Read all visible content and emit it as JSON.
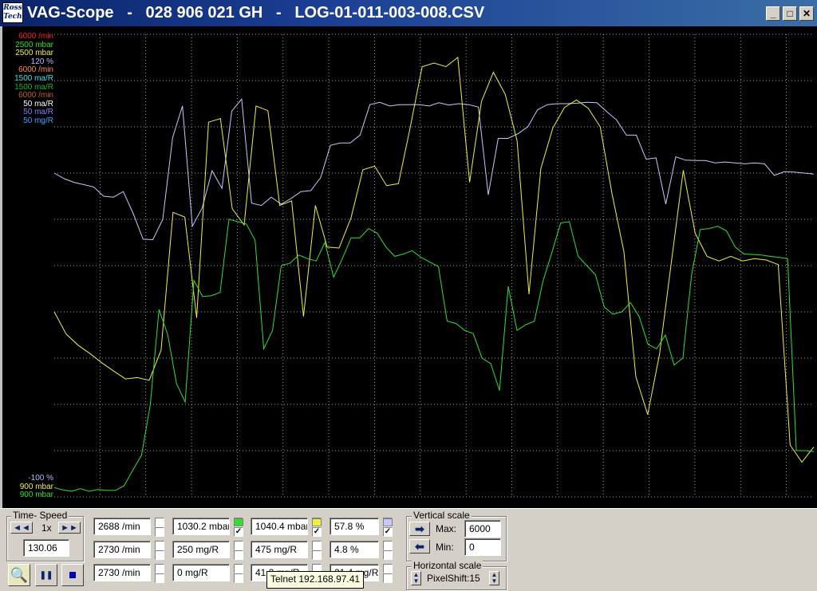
{
  "window": {
    "title": "VAG-Scope   -   028 906 021 GH   -   LOG-01-011-003-008.CSV",
    "logo": "Ross Tech"
  },
  "scale_labels_top": [
    {
      "text": "6000 /min",
      "color": "#ff2020"
    },
    {
      "text": "2500 mbar",
      "color": "#30e030"
    },
    {
      "text": "2500 mbar",
      "color": "#f0f040"
    },
    {
      "text": "120 %",
      "color": "#b8b8ff"
    },
    {
      "text": "6000 /min",
      "color": "#ff9040"
    },
    {
      "text": "1500 ma/R",
      "color": "#40e0e0"
    },
    {
      "text": "1500 ma/R",
      "color": "#20b020"
    },
    {
      "text": "6000 /min",
      "color": "#c06030"
    },
    {
      "text": "50 ma/R",
      "color": "#ffffff"
    },
    {
      "text": "50 ma/R",
      "color": "#8080ff"
    },
    {
      "text": "50 mg/R",
      "color": "#40a0ff"
    }
  ],
  "scale_labels_bottom": [
    {
      "text": "-100 %",
      "color": "#b8b8ff"
    },
    {
      "text": "900 mbar",
      "color": "#f0f040"
    },
    {
      "text": "900 mbar",
      "color": "#30e030"
    }
  ],
  "chart_data": {
    "type": "line",
    "ylim": [
      0,
      1000
    ],
    "grid": true,
    "series": [
      {
        "color": "#c8c8ff",
        "values": [
          700,
          688,
          680,
          675,
          670,
          650,
          648,
          660,
          613,
          557,
          556,
          600,
          777,
          845,
          585,
          625,
          705,
          667,
          834,
          860,
          635,
          630,
          648,
          633,
          645,
          660,
          662,
          690,
          760,
          765,
          765,
          782,
          848,
          853,
          845,
          848,
          848,
          848,
          845,
          852,
          847,
          850,
          848,
          843,
          653,
          775,
          775,
          785,
          800,
          837,
          848,
          850,
          850,
          851,
          853,
          852,
          833,
          815,
          782,
          782,
          730,
          733,
          633,
          735,
          728,
          727,
          727,
          722,
          724,
          722,
          720,
          722,
          720,
          695,
          703,
          702,
          700,
          698
        ]
      },
      {
        "color": "#f0f040",
        "values": [
          400,
          352,
          328,
          310,
          290,
          272,
          255,
          258,
          252,
          317,
          615,
          605,
          387,
          810,
          818,
          623,
          588,
          845,
          835,
          630,
          640,
          390,
          630,
          540,
          538,
          603,
          707,
          715,
          673,
          677,
          800,
          930,
          938,
          930,
          950,
          680,
          855,
          918,
          870,
          770,
          438,
          710,
          797,
          842,
          858,
          840,
          800,
          655,
          530,
          260,
          178,
          308,
          508,
          706,
          570,
          520,
          510,
          520,
          510,
          515,
          512,
          502,
          112,
          75,
          108
        ]
      },
      {
        "color": "#30e030",
        "values": [
          20,
          15,
          12,
          18,
          12,
          16,
          14,
          14,
          24,
          58,
          90,
          200,
          405,
          350,
          245,
          205,
          468,
          433,
          435,
          442,
          600,
          595,
          590,
          555,
          320,
          360,
          500,
          505,
          523,
          515,
          510,
          550,
          475,
          515,
          560,
          560,
          580,
          570,
          540,
          520,
          525,
          532,
          518,
          508,
          498,
          380,
          375,
          360,
          353,
          300,
          288,
          230,
          455,
          360,
          372,
          380,
          468,
          528,
          592,
          595,
          520,
          500,
          480,
          410,
          395,
          400,
          420,
          390,
          330,
          320,
          350,
          285,
          300,
          480,
          578,
          580,
          585,
          575,
          540,
          525,
          524,
          523,
          520,
          518,
          515,
          100,
          100,
          98
        ]
      }
    ]
  },
  "controls": {
    "time_speed": {
      "label": "Time- Speed",
      "speed": "1x",
      "time_value": "130.06"
    },
    "values": [
      [
        "2688 /min",
        "1030.2 mbar",
        "1040.4 mbar",
        "57.8 %"
      ],
      [
        "2730 /min",
        "250 mg/R",
        "475 mg/R",
        "4.8 %"
      ],
      [
        "2730 /min",
        "0 mg/R",
        "41.2 mg/R",
        "21.4 mg/R"
      ]
    ],
    "swatch_colors": [
      "#30e030",
      "#f0f040",
      "#c8c8ff"
    ],
    "vertical_scale": {
      "label": "Vertical scale",
      "max_label": "Max:",
      "max_value": "6000",
      "min_label": "Min:",
      "min_value": "0"
    },
    "horizontal_scale": {
      "label": "Horizontal scale",
      "pixelshift": "PixelShift:15"
    },
    "tooltip": "Telnet 192.168.97.41"
  }
}
